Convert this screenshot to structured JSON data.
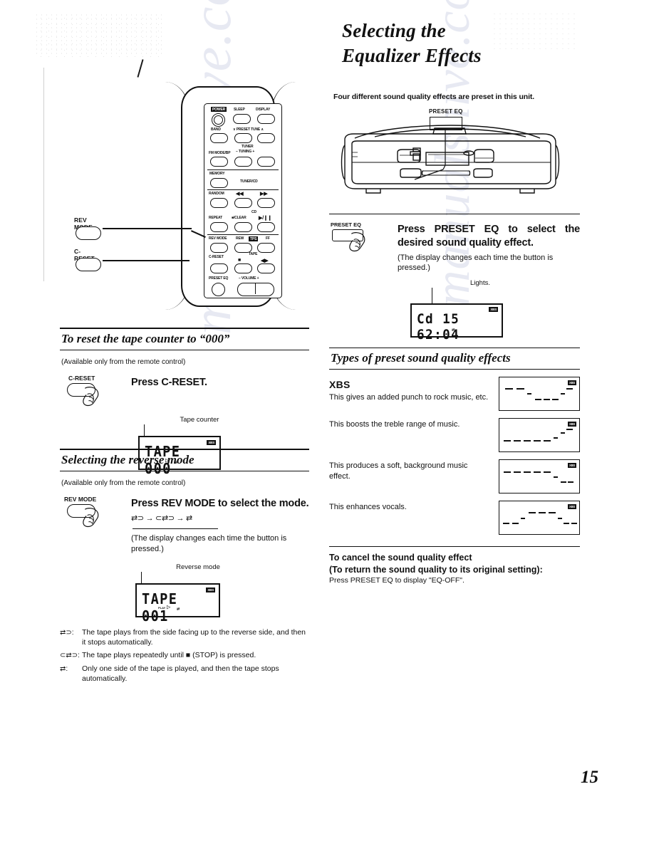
{
  "page": {
    "number": "15"
  },
  "watermark": {
    "text1": "manualshive.com",
    "text2": "manualshive.com"
  },
  "right_column": {
    "chapter_title_line1": "Selecting the",
    "chapter_title_line2": "Equalizer Effects",
    "intro": "Four different sound quality effects are preset in this unit.",
    "unit_callout_label": "PRESET EQ",
    "step": {
      "button_label": "PRESET EQ",
      "title": "Press PRESET EQ to select the desired sound quality effect.",
      "subtitle": "(The display changes each time the button is pressed.)",
      "display_caption": "Lights.",
      "lcd_main": "Cd 15  62:04",
      "lcd_badge": "XBS"
    },
    "types_heading": "Types of preset sound quality effects",
    "effects": [
      {
        "name": "XBS",
        "description": "This gives an added punch to rock music, etc.",
        "badge": "XBS",
        "curve": [
          78,
          78,
          52,
          34,
          34,
          34,
          52,
          74,
          86
        ]
      },
      {
        "name": "",
        "description": "This boosts the treble range of music.",
        "badge": "XBS",
        "curve": [
          30,
          30,
          30,
          30,
          30,
          30,
          46,
          70,
          84
        ]
      },
      {
        "name": "",
        "description": "This produces a soft, background music effect.",
        "badge": "XBS",
        "curve": [
          78,
          78,
          78,
          78,
          78,
          78,
          54,
          34,
          34
        ]
      },
      {
        "name": "",
        "description": "This enhances vocals.",
        "badge": "XBS",
        "curve": [
          34,
          34,
          52,
          76,
          80,
          80,
          56,
          34,
          34
        ]
      }
    ],
    "cancel": {
      "heading_line1": "To cancel the sound quality effect",
      "heading_line2": "(To return the sound quality to its original setting):",
      "body": "Press PRESET EQ to display \"EQ-OFF\"."
    }
  },
  "left_column": {
    "remote": {
      "callouts": [
        {
          "label": "REV MODE"
        },
        {
          "label": "C-RESET"
        }
      ],
      "buttons": [
        {
          "label": "POWER",
          "style": "inverted"
        },
        {
          "label": "SLEEP"
        },
        {
          "label": "DISPLAY"
        },
        {
          "label": "BAND"
        },
        {
          "label": "∨ PRESET TUNE ∧"
        },
        {
          "label": "FM MODE/BP"
        },
        {
          "label": "TUNER"
        },
        {
          "label": "– TUNING +"
        },
        {
          "label": "MEMORY"
        },
        {
          "label": "TUNER/CD"
        },
        {
          "label": "RANDOM"
        },
        {
          "label": "◀◀"
        },
        {
          "label": "▶▶"
        },
        {
          "label": "CD"
        },
        {
          "label": "REPEAT"
        },
        {
          "label": "■/CLEAR"
        },
        {
          "label": "▶/❙❙"
        },
        {
          "label": "REV MODE"
        },
        {
          "label": "REW"
        },
        {
          "label": "TPS",
          "style": "inverted"
        },
        {
          "label": "FF"
        },
        {
          "label": "C-RESET"
        },
        {
          "label": "TAPE"
        },
        {
          "label": "■"
        },
        {
          "label": "◀▶"
        },
        {
          "label": "PRESET EQ"
        },
        {
          "label": "– VOLUME +"
        }
      ]
    },
    "section_counter": {
      "heading": "To reset the tape counter to “000”",
      "note": "(Available only from the remote control)",
      "button_label": "C-RESET",
      "step_title": "Press C-RESET.",
      "display_caption": "Tape counter",
      "lcd_main": "TAPE  000",
      "lcd_badge": "XBS"
    },
    "section_reverse": {
      "heading": "Selecting the reverse mode",
      "note": "(Available only from the remote control)",
      "button_label": "REV MODE",
      "step_title": "Press REV MODE to select the mode.",
      "mode_sequence": "⇄⊃ → ⊂⇄⊃ → ⇄",
      "subtitle": "(The display changes each time the button is pressed.)",
      "display_caption": "Reverse mode",
      "lcd_main": "TAPE  001",
      "lcd_badge": "XBS",
      "modes": [
        {
          "symbol": "⇄⊃:",
          "text": "The tape plays from the side facing up to the reverse side, and then it stops automatically."
        },
        {
          "symbol": "⊂⇄⊃:",
          "text": "The tape plays repeatedly until ■ (STOP) is pressed."
        },
        {
          "symbol": "⇄:",
          "text": "Only one side of the tape is played, and then the tape stops automatically."
        }
      ]
    }
  }
}
